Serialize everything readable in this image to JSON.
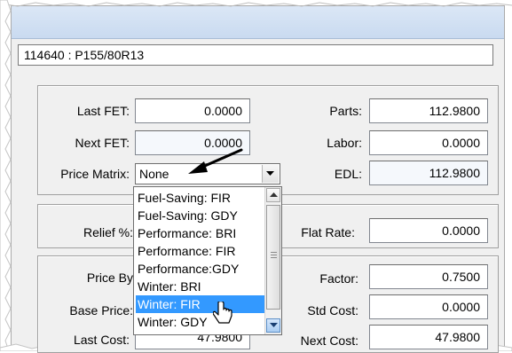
{
  "record": {
    "text": "114640 : P155/80R13"
  },
  "fet": {
    "last_label": "Last FET:",
    "last_value": "0.0000",
    "next_label": "Next FET:",
    "next_value": "0.0000",
    "matrix_label": "Price Matrix:",
    "matrix_value": "None"
  },
  "costs": {
    "parts_label": "Parts:",
    "parts_value": "112.9800",
    "labor_label": "Labor:",
    "labor_value": "0.0000",
    "edl_label": "EDL:",
    "edl_value": "112.9800"
  },
  "relief": {
    "label": "Relief %:",
    "flat_label": "Flat Rate:",
    "flat_value": "0.0000"
  },
  "pricing": {
    "price_by_label": "Price By",
    "base_label": "Base Price:",
    "last_cost_label": "Last Cost:",
    "last_cost_value": "47.9800",
    "factor_label": "Factor:",
    "factor_value": "0.7500",
    "std_cost_label": "Std Cost:",
    "std_cost_value": "0.0000",
    "next_cost_label": "Next Cost:",
    "next_cost_value": "47.9800"
  },
  "dropdown": {
    "options": [
      "Fuel-Saving: FIR",
      "Fuel-Saving: GDY",
      "Performance: BRI",
      "Performance: FIR",
      "Performance:GDY",
      "Winter: BRI",
      "Winter: FIR",
      "Winter: GDY"
    ],
    "selected": "Winter: FIR"
  },
  "icons": {
    "arrow": "callout-arrow-icon",
    "cursor": "hand-cursor-icon"
  }
}
